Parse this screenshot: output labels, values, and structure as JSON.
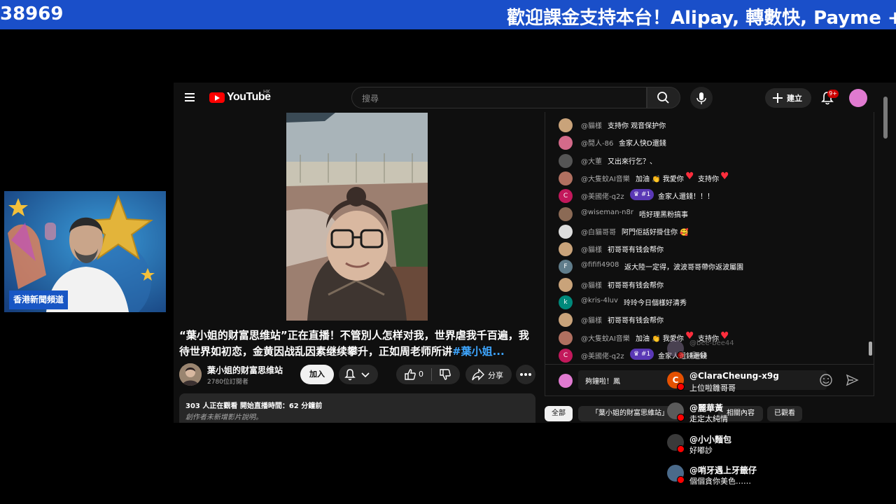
{
  "ticker": {
    "left": "38969",
    "right": "歡迎課金支持本台！Alipay, 轉數快, Payme +"
  },
  "host": {
    "caption": "香港新聞頻道"
  },
  "youtube": {
    "logo": "YouTube",
    "region": "HK",
    "search_placeholder": "搜尋",
    "create_label": "建立",
    "notifications": "9+"
  },
  "video": {
    "title_part1": "“葉小姐的财富思维站”正在直播！不管別人怎样对我，世界虐我千百遍，我待世界如初恋，金黄因战乱因素继续攀升，正如周老师所讲",
    "title_link": "#葉小姐...",
    "channel_name": "葉小姐的财富思维站",
    "subscribers": "2780位訂閱者",
    "join_label": "加入",
    "like_count": "0",
    "share_label": "分享",
    "desc_line1": "303 人正在觀看  開始直播時間：62 分鐘前",
    "desc_line2": "創作者未新增影片說明。"
  },
  "chat": {
    "messages": [
      {
        "author": "@貓樣",
        "text": "支持你 观音保护你",
        "avatar": "",
        "color": "#c9a37a"
      },
      {
        "author": "@閒人-86",
        "text": "金家人快D還錢",
        "avatar": "",
        "color": "#d46a8a"
      },
      {
        "author": "@大董",
        "text": "又出來行乞？、",
        "avatar": "",
        "color": "#555555"
      },
      {
        "author": "@大隻蚊AI音樂",
        "text": "加油 👏 我愛你",
        "text2": "支持你",
        "avatar": "",
        "color": "#b07060"
      },
      {
        "author": "@美國佬-q2z",
        "badge": "#1",
        "text": "金家人還錢！！！",
        "avatar": "C",
        "color": "#c2185b"
      },
      {
        "author": "@wiseman-n8r",
        "text": "唔好理黑粉搞事",
        "avatar": "",
        "color": "#8b6a55"
      },
      {
        "author": "@白貓哥哥",
        "text": "阿門佢話好掛住你 🥰",
        "avatar": "",
        "color": "#dddddd"
      },
      {
        "author": "@貓樣",
        "text": "初哥哥有钱会帮你",
        "avatar": "",
        "color": "#c9a37a"
      },
      {
        "author": "@fififi4908",
        "text": "返大陸一定得，波波哥哥帶你返波屬園",
        "avatar": "F",
        "color": "#607d8b"
      },
      {
        "author": "@貓樣",
        "text": "初哥哥有钱会帮你",
        "avatar": "",
        "color": "#c9a37a"
      },
      {
        "author": "@kris-4luv",
        "text": "玲玲今日個樣好清秀",
        "avatar": "k",
        "color": "#00897b"
      },
      {
        "author": "@貓樣",
        "text": "初哥哥有钱会帮你",
        "avatar": "",
        "color": "#c9a37a"
      },
      {
        "author": "@大隻蚊AI音樂",
        "text": "加油 👏 我愛你",
        "text2": "支持你",
        "avatar": "",
        "color": "#b07060"
      },
      {
        "author": "@美國佬-q2z",
        "badge": "#1",
        "text": "金家人還錢還錢",
        "avatar": "C",
        "color": "#c2185b"
      }
    ],
    "input_text": "夠鐘啦！鳳",
    "filters": [
      "全部",
      "「葉小姐的財富思維站」",
      "相關內容",
      "已觀看"
    ]
  },
  "overlay": [
    {
      "name": "@bee-bee44",
      "text": "😂😂",
      "color": "#7a6a88"
    },
    {
      "name": "@ClaraCheung-x9g",
      "text": "上位啦雛哥哥",
      "color": "#e65100",
      "initial": "C"
    },
    {
      "name": "@麗華黃",
      "text": "走定太純情",
      "color": "#5a5a5a"
    },
    {
      "name": "@小小麵包",
      "text": "好嘟訬",
      "color": "#3a3a3a"
    },
    {
      "name": "@哨牙遇上牙籤仔",
      "text": "個個貪你美色……",
      "color": "#4a6a8a"
    }
  ]
}
